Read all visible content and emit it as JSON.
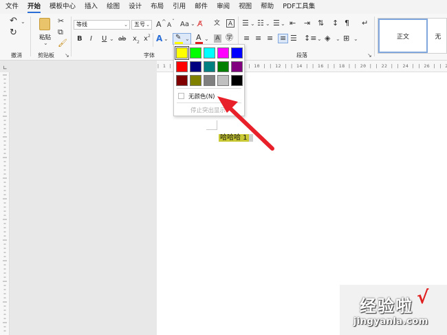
{
  "menu": {
    "items": [
      "文件",
      "开始",
      "模板中心",
      "插入",
      "绘图",
      "设计",
      "布局",
      "引用",
      "邮件",
      "审阅",
      "视图",
      "帮助",
      "PDF工具集"
    ],
    "active": "开始"
  },
  "ribbon": {
    "undo_group_label": "撤消",
    "clipboard_group_label": "剪贴板",
    "paste_label": "粘贴",
    "font_group_label": "字体",
    "paragraph_group_label": "段落",
    "font_name": "等线",
    "font_size": "五号",
    "grow_font": "A",
    "shrink_font": "A",
    "change_case": "Aa",
    "bold": "B",
    "italic": "I",
    "underline": "U",
    "strikethrough": "ab",
    "subscript": "x",
    "superscript": "x",
    "text_effects": "A",
    "font_color": "A",
    "char_shading": "A",
    "styles": [
      "正文",
      "无"
    ]
  },
  "ruler": {
    "text": "| 1 | | 2 | | 4 | | 6 | | 8 | | 10 | | 12 | | 14 | | 16 | | 18 | | 20 | | 22 | | 24 | | 26 | | 28 | | 30 | | 32 | | 34 | | 36 | | 38 |"
  },
  "highlight_dropdown": {
    "colors": [
      [
        "#ffff00",
        "#00ff00",
        "#00ffff",
        "#ff00ff",
        "#0000ff"
      ],
      [
        "#ff0000",
        "#000080",
        "#008080",
        "#008000",
        "#800080"
      ],
      [
        "#800000",
        "#808000",
        "#808080",
        "#c0c0c0",
        "#000000"
      ]
    ],
    "selected_color": "#ffff00",
    "no_color_label": "无颜色(N)",
    "stop_highlight_label": "停止突出显示"
  },
  "document": {
    "text": "哈哈哈 1",
    "highlight_color": "#c9c935"
  },
  "watermark": {
    "line1": "经验啦",
    "check": "√",
    "line2": "jingyanla.com"
  },
  "colors": {
    "accent": "#2b6fd6",
    "arrow": "#e8202a"
  }
}
